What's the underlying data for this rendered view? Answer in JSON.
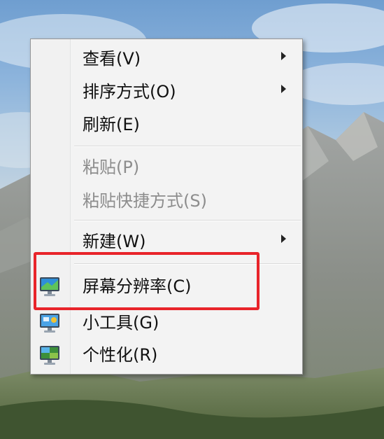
{
  "menu": {
    "items": [
      {
        "label": "查看(V)",
        "submenu": true,
        "disabled": false
      },
      {
        "label": "排序方式(O)",
        "submenu": true,
        "disabled": false
      },
      {
        "label": "刷新(E)",
        "submenu": false,
        "disabled": false
      },
      {
        "label": "粘贴(P)",
        "submenu": false,
        "disabled": true
      },
      {
        "label": "粘贴快捷方式(S)",
        "submenu": false,
        "disabled": true
      },
      {
        "label": "新建(W)",
        "submenu": true,
        "disabled": false
      },
      {
        "label": "屏幕分辨率(C)",
        "submenu": false,
        "disabled": false,
        "icon": "screen-resolution-icon"
      },
      {
        "label": "小工具(G)",
        "submenu": false,
        "disabled": false,
        "icon": "gadgets-icon"
      },
      {
        "label": "个性化(R)",
        "submenu": false,
        "disabled": false,
        "icon": "personalize-icon"
      }
    ]
  },
  "colors": {
    "highlight_border": "#e8242a",
    "menu_background": "#f3f3f3",
    "disabled_text": "#8d8d8d"
  }
}
